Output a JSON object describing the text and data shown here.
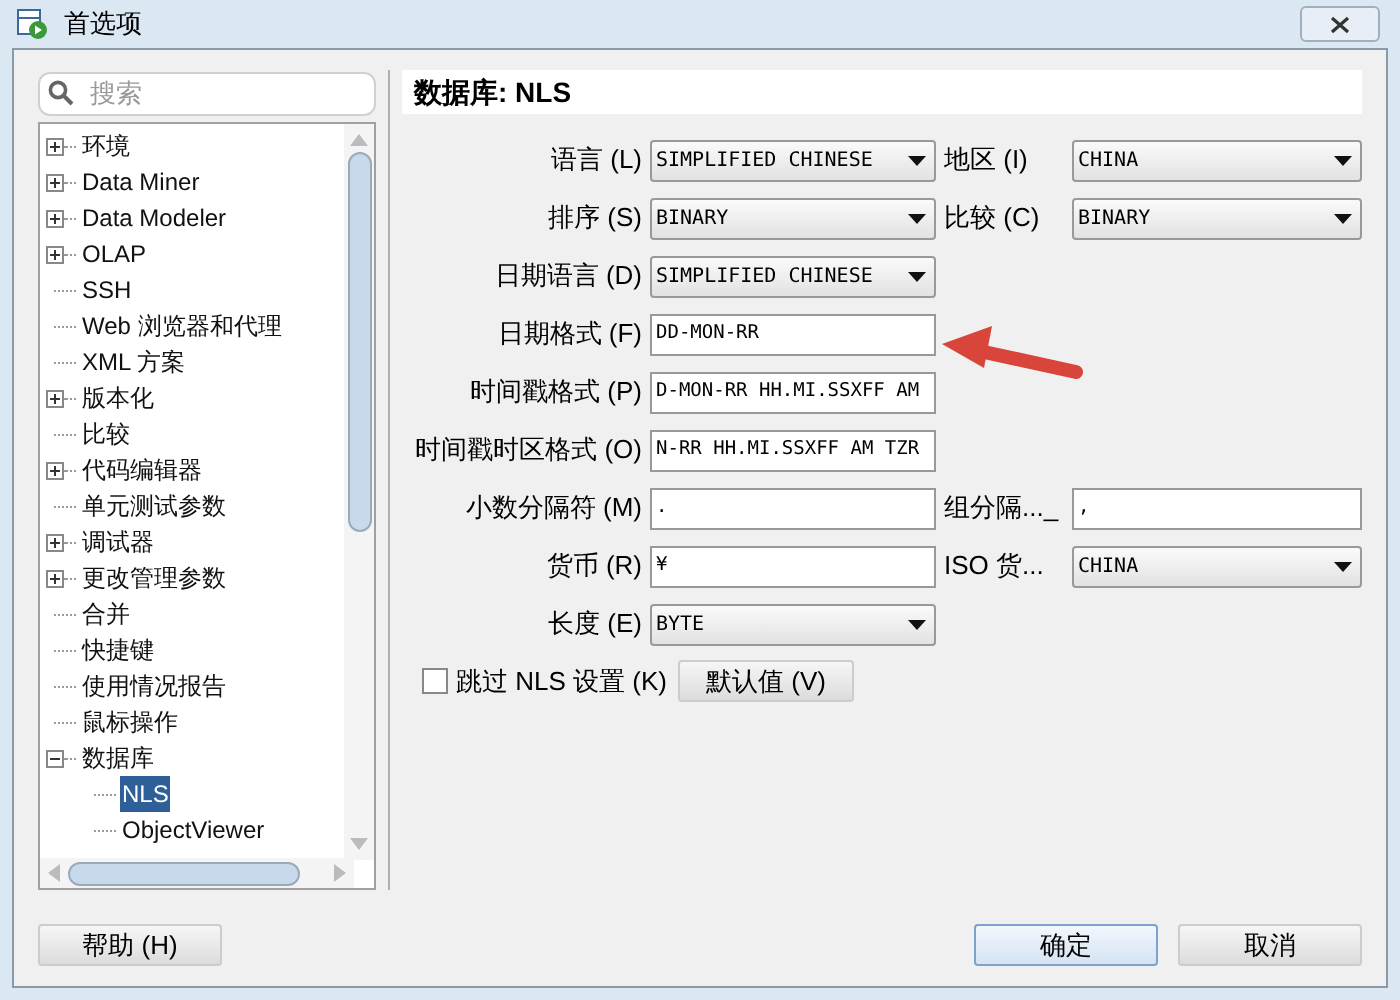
{
  "window": {
    "title": "首选项"
  },
  "search": {
    "placeholder": "搜索"
  },
  "tree": [
    {
      "label": "环境",
      "expanded": false,
      "selected": false
    },
    {
      "label": "Data Miner",
      "expanded": false,
      "selected": false
    },
    {
      "label": "Data Modeler",
      "expanded": false,
      "selected": false
    },
    {
      "label": "OLAP",
      "expanded": false,
      "selected": false
    },
    {
      "label": "SSH",
      "selected": false
    },
    {
      "label": "Web 浏览器和代理",
      "selected": false
    },
    {
      "label": "XML 方案",
      "selected": false
    },
    {
      "label": "版本化",
      "expanded": false,
      "selected": false
    },
    {
      "label": "比较",
      "selected": false
    },
    {
      "label": "代码编辑器",
      "expanded": false,
      "selected": false
    },
    {
      "label": "单元测试参数",
      "selected": false
    },
    {
      "label": "调试器",
      "expanded": false,
      "selected": false
    },
    {
      "label": "更改管理参数",
      "expanded": false,
      "selected": false
    },
    {
      "label": "合并",
      "selected": false
    },
    {
      "label": "快捷键",
      "selected": false
    },
    {
      "label": "使用情况报告",
      "selected": false
    },
    {
      "label": "鼠标操作",
      "selected": false
    },
    {
      "label": "数据库",
      "expanded": true,
      "selected": false,
      "children": [
        {
          "label": "NLS",
          "selected": true
        },
        {
          "label": "ObjectViewer",
          "selected": false
        }
      ]
    }
  ],
  "panel": {
    "title": "数据库: NLS"
  },
  "rows": [
    {
      "label": "语言 (L)",
      "kind": "select",
      "value": "SIMPLIFIED CHINESE",
      "right": {
        "label": "地区 (I)",
        "kind": "select",
        "value": "CHINA"
      }
    },
    {
      "label": "排序 (S)",
      "kind": "select",
      "value": "BINARY",
      "right": {
        "label": "比较 (C)",
        "kind": "select",
        "value": "BINARY"
      }
    },
    {
      "label": "日期语言 (D)",
      "kind": "select",
      "value": "SIMPLIFIED CHINESE"
    },
    {
      "label": "日期格式 (F)",
      "kind": "text",
      "value": "DD-MON-RR"
    },
    {
      "label": "时间戳格式 (P)",
      "kind": "text",
      "value": "D-MON-RR HH.MI.SSXFF AM"
    },
    {
      "label": "时间戳时区格式 (O)",
      "kind": "text",
      "value": "N-RR HH.MI.SSXFF AM TZR"
    },
    {
      "label": "小数分隔符 (M)",
      "kind": "text",
      "value": ".",
      "right": {
        "label": "组分隔..._",
        "kind": "text",
        "value": ","
      }
    },
    {
      "label": "货币 (R)",
      "kind": "text",
      "value": "¥",
      "right": {
        "label": "ISO 货...",
        "kind": "select",
        "value": "CHINA"
      }
    },
    {
      "label": "长度 (E)",
      "kind": "select",
      "value": "BYTE"
    }
  ],
  "skip_checkbox": {
    "label": "跳过 NLS 设置 (K)",
    "checked": false
  },
  "default_button": "默认值 (V)",
  "buttons": {
    "help": "帮助 (H)",
    "ok": "确定",
    "cancel": "取消"
  }
}
